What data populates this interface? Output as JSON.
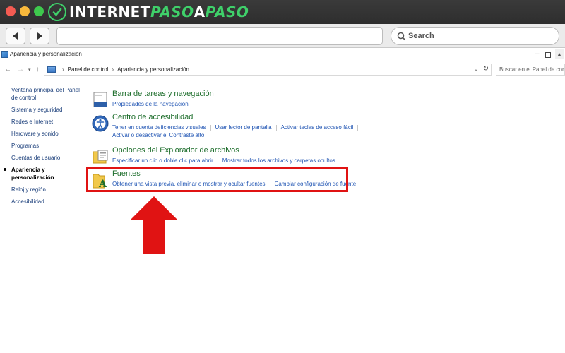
{
  "browser": {
    "brand": {
      "part1": "INTERNET",
      "part2": "PASO",
      "part3": "A",
      "part4": "PASO"
    },
    "search_placeholder": "Search"
  },
  "window": {
    "title": "Apariencia y personalización"
  },
  "address": {
    "breadcrumb": [
      "Panel de control",
      "Apariencia y personalización"
    ],
    "search_placeholder": "Buscar en el Panel de control"
  },
  "sidebar": {
    "items": [
      {
        "label": "Ventana principal del Panel de control",
        "active": false
      },
      {
        "label": "Sistema y seguridad",
        "active": false
      },
      {
        "label": "Redes e Internet",
        "active": false
      },
      {
        "label": "Hardware y sonido",
        "active": false
      },
      {
        "label": "Programas",
        "active": false
      },
      {
        "label": "Cuentas de usuario",
        "active": false
      },
      {
        "label": "Apariencia y personalización",
        "active": true
      },
      {
        "label": "Reloj y región",
        "active": false
      },
      {
        "label": "Accesibilidad",
        "active": false
      }
    ]
  },
  "categories": [
    {
      "title": "Barra de tareas y navegación",
      "links": [
        "Propiedades de la navegación"
      ]
    },
    {
      "title": "Centro de accesibilidad",
      "links": [
        "Tener en cuenta deficiencias visuales",
        "Usar lector de pantalla",
        "Activar teclas de acceso fácil",
        "Activar o desactivar el Contraste alto"
      ]
    },
    {
      "title": "Opciones del Explorador de archivos",
      "links": [
        "Especificar un clic o doble clic para abrir",
        "Mostrar todos los archivos y carpetas ocultos"
      ]
    },
    {
      "title": "Fuentes",
      "links": [
        "Obtener una vista previa, eliminar o mostrar y ocultar fuentes",
        "Cambiar configuración de fuente"
      ]
    }
  ],
  "colors": {
    "highlight": "#e01313",
    "arrow": "#e01313",
    "category_title": "#1e6e2c",
    "link": "#1f54b3",
    "brand_accent": "#3fd06a"
  }
}
